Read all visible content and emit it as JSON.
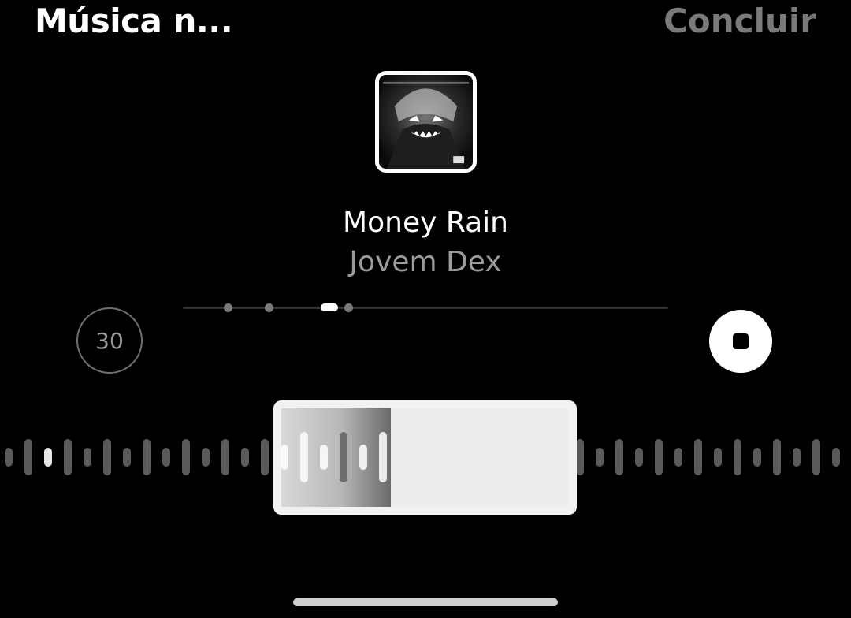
{
  "header": {
    "title": "Música n...",
    "done_label": "Concluir"
  },
  "song": {
    "title": "Money Rain",
    "artist": "Jovem Dex"
  },
  "controls": {
    "duration_label": "30",
    "stop_icon": "stop-icon"
  },
  "track_indicator": {
    "count": 4,
    "active_index": 2
  },
  "playback": {
    "progress_within_selection": 0.38
  },
  "colors": {
    "background": "#000000",
    "primary_text": "#ffffff",
    "secondary_text": "#9b9b9b",
    "disabled_text": "#7a7a7a"
  }
}
